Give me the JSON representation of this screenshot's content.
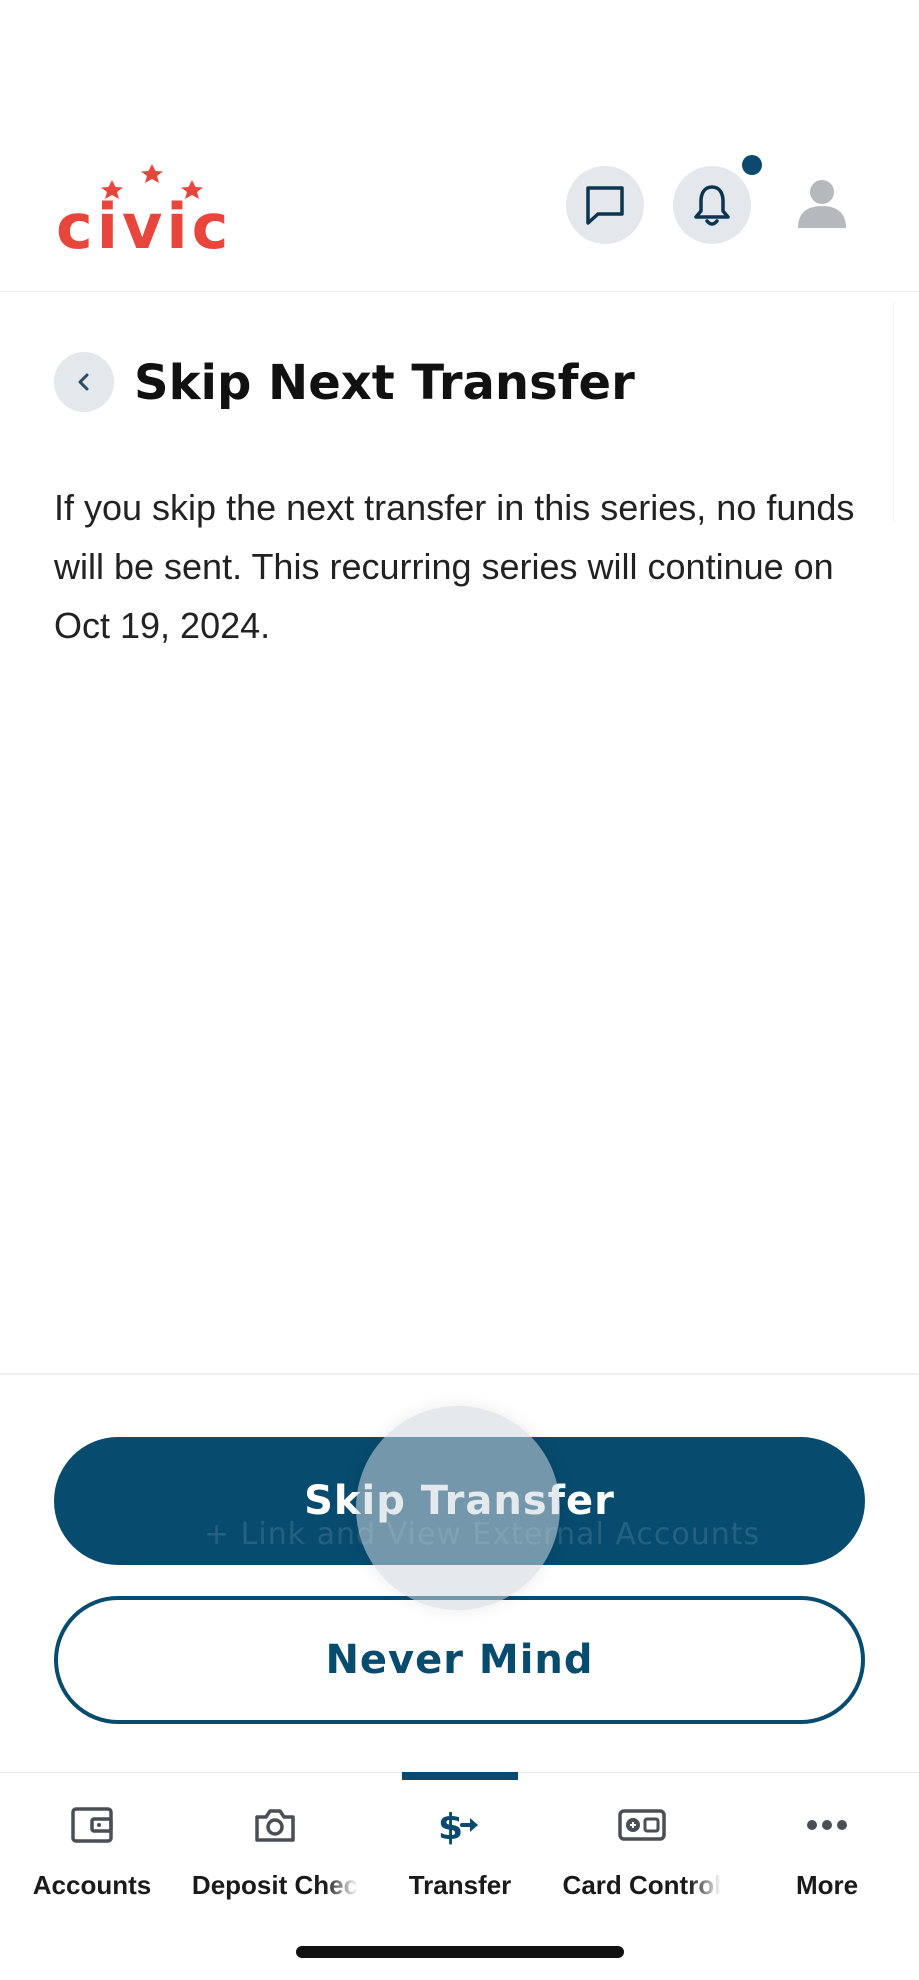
{
  "brand": {
    "name": "civic",
    "color": "#e8463c",
    "accent": "#0b4a6e"
  },
  "header": {
    "icons": [
      "chat-icon",
      "bell-icon",
      "profile-icon"
    ],
    "has_notification": true
  },
  "page": {
    "title": "Skip Next Transfer",
    "description": "If you skip the next transfer in this series, no funds will be sent. This recurring series will continue on Oct 19, 2024."
  },
  "actions": {
    "primary_label": "Skip Transfer",
    "secondary_label": "Never Mind",
    "ghost_text": "+ Link and View External Accounts"
  },
  "tabbar": {
    "active": "Transfer",
    "items": [
      {
        "label": "Accounts",
        "icon": "wallet-icon"
      },
      {
        "label": "Deposit Chec",
        "icon": "camera-icon"
      },
      {
        "label": "Transfer",
        "icon": "transfer-icon"
      },
      {
        "label": "Card Control",
        "icon": "card-control-icon"
      },
      {
        "label": "More",
        "icon": "more-icon"
      }
    ]
  }
}
